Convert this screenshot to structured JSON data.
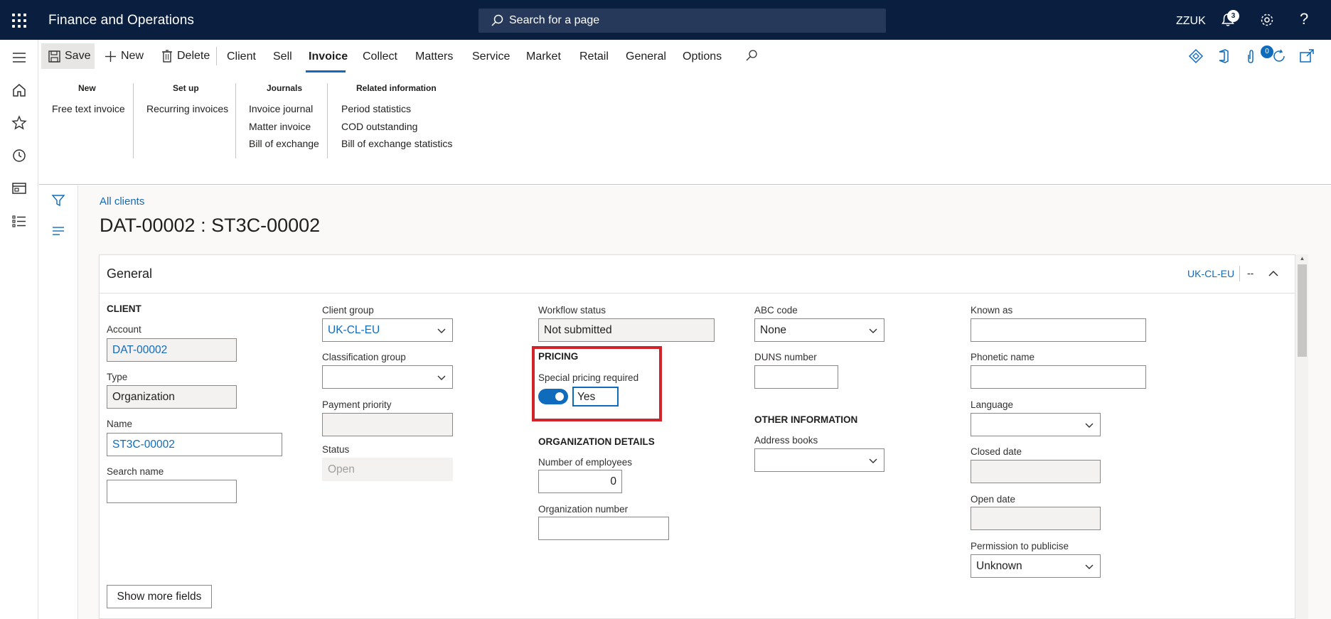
{
  "header": {
    "app_title": "Finance and Operations",
    "search_placeholder": "Search for a page",
    "company": "ZZUK",
    "notification_count": "3"
  },
  "actionpane": {
    "save_label": "Save",
    "new_label": "New",
    "delete_label": "Delete",
    "tabs": [
      {
        "label": "Client"
      },
      {
        "label": "Sell"
      },
      {
        "label": "Invoice"
      },
      {
        "label": "Collect"
      },
      {
        "label": "Matters"
      },
      {
        "label": "Service"
      },
      {
        "label": "Market"
      },
      {
        "label": "Retail"
      },
      {
        "label": "General"
      },
      {
        "label": "Options"
      }
    ],
    "active_tab": "Invoice",
    "attach_count": "0",
    "groups": [
      {
        "title": "New",
        "items": [
          "Free text invoice"
        ]
      },
      {
        "title": "Set up",
        "items": [
          "Recurring invoices"
        ]
      },
      {
        "title": "Journals",
        "items": [
          "Invoice journal",
          "Matter invoice",
          "Bill of exchange"
        ]
      },
      {
        "title": "Related information",
        "items": [
          "Period statistics",
          "COD outstanding",
          "Bill of exchange statistics"
        ]
      }
    ]
  },
  "page": {
    "breadcrumb": "All clients",
    "title": "DAT-00002 : ST3C-00002"
  },
  "general": {
    "title": "General",
    "summary_tag": "UK-CL-EU",
    "summary_dash": "--",
    "client_section": "CLIENT",
    "account_label": "Account",
    "account_value": "DAT-00002",
    "type_label": "Type",
    "type_value": "Organization",
    "name_label": "Name",
    "name_value": "ST3C-00002",
    "search_name_label": "Search name",
    "search_name_value": "",
    "client_group_label": "Client group",
    "client_group_value": "UK-CL-EU",
    "classification_group_label": "Classification group",
    "classification_group_value": "",
    "payment_priority_label": "Payment priority",
    "payment_priority_value": "",
    "status_label": "Status",
    "status_value": "Open",
    "workflow_status_label": "Workflow status",
    "workflow_status_value": "Not submitted",
    "pricing_section": "PRICING",
    "special_pricing_label": "Special pricing required",
    "special_pricing_value": "Yes",
    "org_details_section": "ORGANIZATION DETAILS",
    "num_employees_label": "Number of employees",
    "num_employees_value": "0",
    "org_number_label": "Organization number",
    "org_number_value": "",
    "abc_code_label": "ABC code",
    "abc_code_value": "None",
    "duns_label": "DUNS number",
    "duns_value": "",
    "other_info_section": "OTHER INFORMATION",
    "address_books_label": "Address books",
    "address_books_value": "",
    "known_as_label": "Known as",
    "known_as_value": "",
    "phonetic_name_label": "Phonetic name",
    "phonetic_name_value": "",
    "language_label": "Language",
    "language_value": "",
    "closed_date_label": "Closed date",
    "closed_date_value": "",
    "open_date_label": "Open date",
    "open_date_value": "",
    "permission_label": "Permission to publicise",
    "permission_value": "Unknown",
    "show_more_label": "Show more fields"
  },
  "colors": {
    "topbar": "#0a1f3f",
    "accent": "#0f6cbd",
    "highlight": "#d1232a"
  }
}
